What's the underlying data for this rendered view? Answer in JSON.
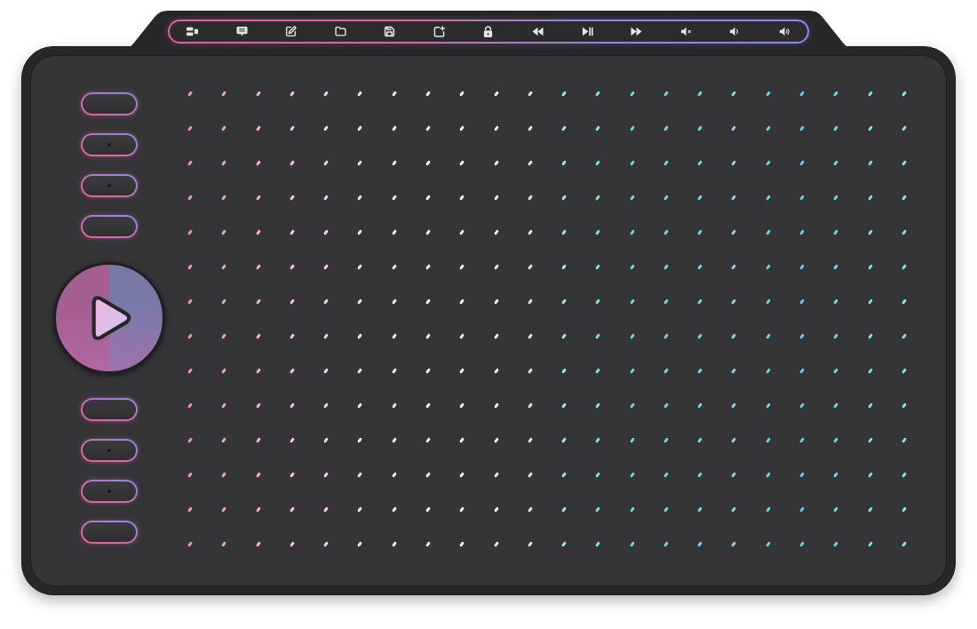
{
  "toolbar": {
    "keys": [
      {
        "kind": "display"
      },
      {
        "kind": "comment"
      },
      {
        "kind": "edit"
      },
      {
        "kind": "folder"
      },
      {
        "kind": "save"
      },
      {
        "kind": "new"
      },
      {
        "kind": "lock"
      },
      {
        "kind": "rewind"
      },
      {
        "kind": "playpause"
      },
      {
        "kind": "forward"
      },
      {
        "kind": "mute"
      },
      {
        "kind": "quieter"
      },
      {
        "kind": "louder"
      }
    ]
  },
  "express_keys": {
    "upper": [
      {
        "kind": "plain"
      },
      {
        "kind": "bumped"
      },
      {
        "kind": "bumped"
      },
      {
        "kind": "plain"
      }
    ],
    "lower": [
      {
        "kind": "plain"
      },
      {
        "kind": "bumped"
      },
      {
        "kind": "bumped"
      },
      {
        "kind": "plain"
      }
    ]
  },
  "drawing_area": {
    "dot_columns": [
      {
        "color": "#ee8fbf"
      },
      {
        "color": "#f29ccb"
      },
      {
        "color": "#f5b0d4"
      },
      {
        "color": "#f7c2dd"
      },
      {
        "color": "#f8d2e4"
      },
      {
        "color": "#f8dfea"
      },
      {
        "color": "#f5e8ee"
      },
      {
        "color": "#f2eef0"
      },
      {
        "color": "#eef1f0"
      },
      {
        "color": "#e6f3ef"
      },
      {
        "color": "#c8f0e4"
      },
      {
        "color": "#9fead8"
      },
      {
        "color": "#7ee3cf"
      },
      {
        "color": "#6ad9d0"
      },
      {
        "color": "#74d4dc"
      },
      {
        "color": "#7ccfe6"
      },
      {
        "color": "#8fd0ea"
      },
      {
        "color": "#6fcfe2"
      },
      {
        "color": "#6cc6ec"
      },
      {
        "color": "#72d3e4"
      },
      {
        "color": "#7fd8e0"
      },
      {
        "color": "#8fdde3"
      }
    ]
  }
}
